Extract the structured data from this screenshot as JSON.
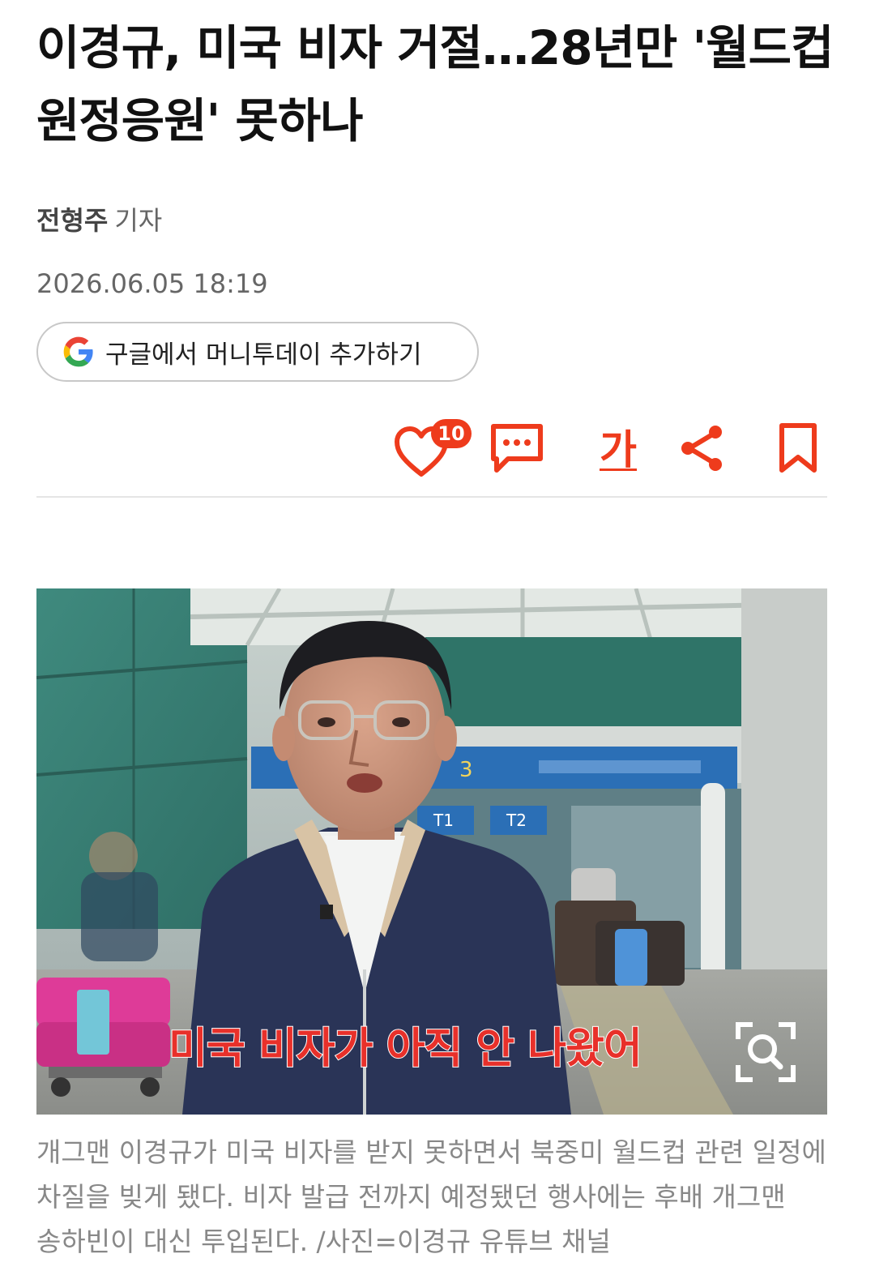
{
  "article": {
    "headline": "이경규, 미국 비자 거절…28년만 '월드컵 원정응원' 못하나",
    "author": "전형주",
    "author_role": "기자",
    "date": "2026.06.05 18:19"
  },
  "google_button": {
    "label": "구글에서 머니투데이 추가하기",
    "icon": "google-g-icon"
  },
  "actions": {
    "like_count": "10",
    "font_size_label": "가",
    "icons": [
      "heart-icon",
      "comment-icon",
      "font-size-icon",
      "share-icon",
      "bookmark-icon"
    ]
  },
  "photo": {
    "subtitle": "미국 비자가 아직 안 나왔어",
    "signage": [
      "3",
      "T1",
      "T2"
    ],
    "zoom_icon": "zoom-search-icon"
  },
  "caption": "개그맨 이경규가 미국 비자를 받지 못하면서 북중미 월드컵 관련 일정에 차질을 빚게 됐다. 비자 발급 전까지 예정됐던 행사에는 후배 개그맨 송하빈이 대신 투입된다. /사진=이경규 유튜브 채널",
  "colors": {
    "accent": "#ee3b1c",
    "text": "#111111",
    "muted": "#888888",
    "divider": "#e5e5e5"
  }
}
